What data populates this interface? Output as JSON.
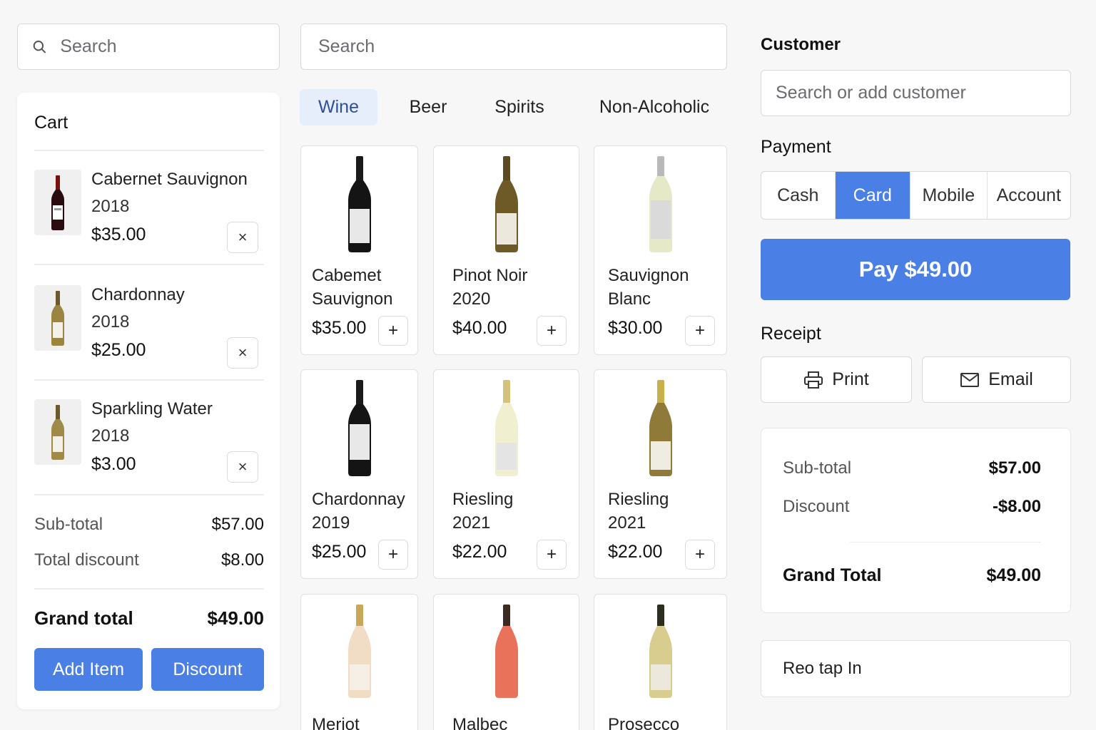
{
  "left_search": {
    "placeholder": "Search",
    "icon": "search-icon"
  },
  "cart": {
    "title": "Cart",
    "items": [
      {
        "name": "Cabernet Sauvignon",
        "year": "2018",
        "price": "$35.00"
      },
      {
        "name": "Chardonnay",
        "year": "2018",
        "price": "$25.00"
      },
      {
        "name": "Sparkling Water",
        "year": "2018",
        "price": "$3.00"
      }
    ],
    "remove_glyph": "×",
    "subtotal_label": "Sub-total",
    "subtotal_value": "$57.00",
    "discount_label": "Total discount",
    "discount_value": "$8.00",
    "grand_label": "Grand total",
    "grand_value": "$49.00",
    "add_item_label": "Add Item",
    "discount_button_label": "Discount"
  },
  "catalog": {
    "search_placeholder": "Search",
    "tabs": [
      {
        "label": "Wine",
        "active": true
      },
      {
        "label": "Beer",
        "active": false
      },
      {
        "label": "Spirits",
        "active": false
      },
      {
        "label": "Non-Alcoholic",
        "active": false
      }
    ],
    "add_glyph": "+",
    "products": [
      {
        "name": "Cabemet",
        "name2": "Sauvignon",
        "price": "$35.00"
      },
      {
        "name": "Pinot Noir",
        "name2": "2020",
        "price": "$40.00"
      },
      {
        "name": "Sauvignon",
        "name2": "Blanc",
        "price": "$30.00"
      },
      {
        "name": "Chardonnay",
        "name2": "2019",
        "price": "$25.00"
      },
      {
        "name": "Riesling",
        "name2": "2021",
        "price": "$22.00"
      },
      {
        "name": "Riesling",
        "name2": "2021",
        "price": "$22.00"
      },
      {
        "name": "Meriot",
        "name2": "",
        "price": ""
      },
      {
        "name": "Malbec",
        "name2": "",
        "price": ""
      },
      {
        "name": "Prosecco",
        "name2": "",
        "price": ""
      }
    ]
  },
  "customer": {
    "title": "Customer",
    "placeholder": "Search or add customer"
  },
  "payment": {
    "title": "Payment",
    "methods": [
      {
        "label": "Cash",
        "active": false
      },
      {
        "label": "Card",
        "active": true
      },
      {
        "label": "Mobile",
        "active": false
      },
      {
        "label": "Account",
        "active": false
      }
    ],
    "pay_label": "Pay $49.00"
  },
  "receipt": {
    "title": "Receipt",
    "print_label": "Print",
    "email_label": "Email"
  },
  "totals": {
    "subtotal_label": "Sub-total",
    "subtotal_value": "$57.00",
    "discount_label": "Discount",
    "discount_value": "-$8.00",
    "grand_label": "Grand Total",
    "grand_value": "$49.00"
  },
  "footer_text": "Reo tap In",
  "colors": {
    "accent": "#4a7fe6",
    "tab_active_bg": "#e6eefb",
    "page_bg": "#f7f7f8"
  }
}
